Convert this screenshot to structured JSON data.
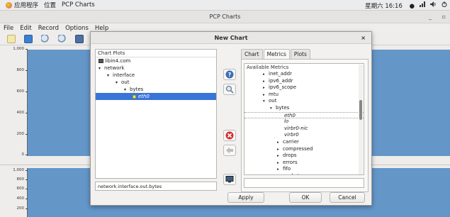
{
  "topbar": {
    "apps": "应用程序",
    "places": "位置",
    "active_app": "PCP Charts",
    "clock": "星期六 16:16",
    "clock_dot": "●",
    "network_icon": "network-icon",
    "volume_icon": "volume-icon",
    "power_icon": "power-icon"
  },
  "window": {
    "title": "PCP Charts",
    "minimize": "_",
    "maximize": "▫"
  },
  "menu": [
    "File",
    "Edit",
    "Record",
    "Options",
    "Help"
  ],
  "toolbar_icons": [
    "new-chart-icon",
    "open-icon",
    "zoom-in-icon",
    "zoom-out-icon",
    "export-icon"
  ],
  "chart1": {
    "ticks": [
      "1,000",
      "800",
      "600",
      "400",
      "200",
      "0"
    ]
  },
  "chart2": {
    "ticks": [
      "1,000",
      "800",
      "600",
      "400",
      "200"
    ]
  },
  "dialog": {
    "title": "New Chart",
    "close": "×",
    "tree_header": "Chart Plots",
    "tree": [
      {
        "label": "libin4.com",
        "level": 0,
        "arrow": "",
        "kind": "host"
      },
      {
        "label": "network",
        "level": 0,
        "arrow": "▾",
        "kind": "node"
      },
      {
        "label": "interface",
        "level": 1,
        "arrow": "▾",
        "kind": "node"
      },
      {
        "label": "out",
        "level": 2,
        "arrow": "▾",
        "kind": "node"
      },
      {
        "label": "bytes",
        "level": 3,
        "arrow": "▾",
        "kind": "node"
      },
      {
        "label": "eth0",
        "level": 4,
        "arrow": "",
        "kind": "leaf",
        "selected": true
      }
    ],
    "path_value": "network.interface.out.bytes",
    "tabs": [
      "Chart",
      "Metrics",
      "Plots"
    ],
    "active_tab": "Metrics",
    "metrics_header": "Available Metrics",
    "metrics": [
      {
        "label": "inet_addr",
        "level": 2,
        "arrow": "▸"
      },
      {
        "label": "ipv6_addr",
        "level": 2,
        "arrow": "▸"
      },
      {
        "label": "ipv6_scope",
        "level": 2,
        "arrow": "▸"
      },
      {
        "label": "mtu",
        "level": 2,
        "arrow": "▸"
      },
      {
        "label": "out",
        "level": 2,
        "arrow": "▾"
      },
      {
        "label": "bytes",
        "level": 3,
        "arrow": "▾"
      },
      {
        "label": "eth0",
        "level": 5,
        "arrow": "",
        "style": "hl"
      },
      {
        "label": "lo",
        "level": 5,
        "arrow": "",
        "style": "it"
      },
      {
        "label": "virbr0-nic",
        "level": 5,
        "arrow": "",
        "style": "it"
      },
      {
        "label": "virbr0",
        "level": 5,
        "arrow": "",
        "style": "it"
      },
      {
        "label": "carrier",
        "level": 4,
        "arrow": "▸"
      },
      {
        "label": "compressed",
        "level": 4,
        "arrow": "▸"
      },
      {
        "label": "drops",
        "level": 4,
        "arrow": "▸"
      },
      {
        "label": "errors",
        "level": 4,
        "arrow": "▸"
      },
      {
        "label": "fifo",
        "level": 4,
        "arrow": "▸"
      },
      {
        "label": "packets",
        "level": 4,
        "arrow": "▸"
      }
    ],
    "buttons": {
      "apply": "Apply",
      "ok": "OK",
      "cancel": "Cancel"
    },
    "side_icons": [
      "info-icon",
      "search-icon",
      "delete-icon",
      "back-arrow-icon",
      "monitor-icon"
    ],
    "colors": {
      "selection": "#3875d7",
      "plot_bg": "#6496c8"
    }
  }
}
